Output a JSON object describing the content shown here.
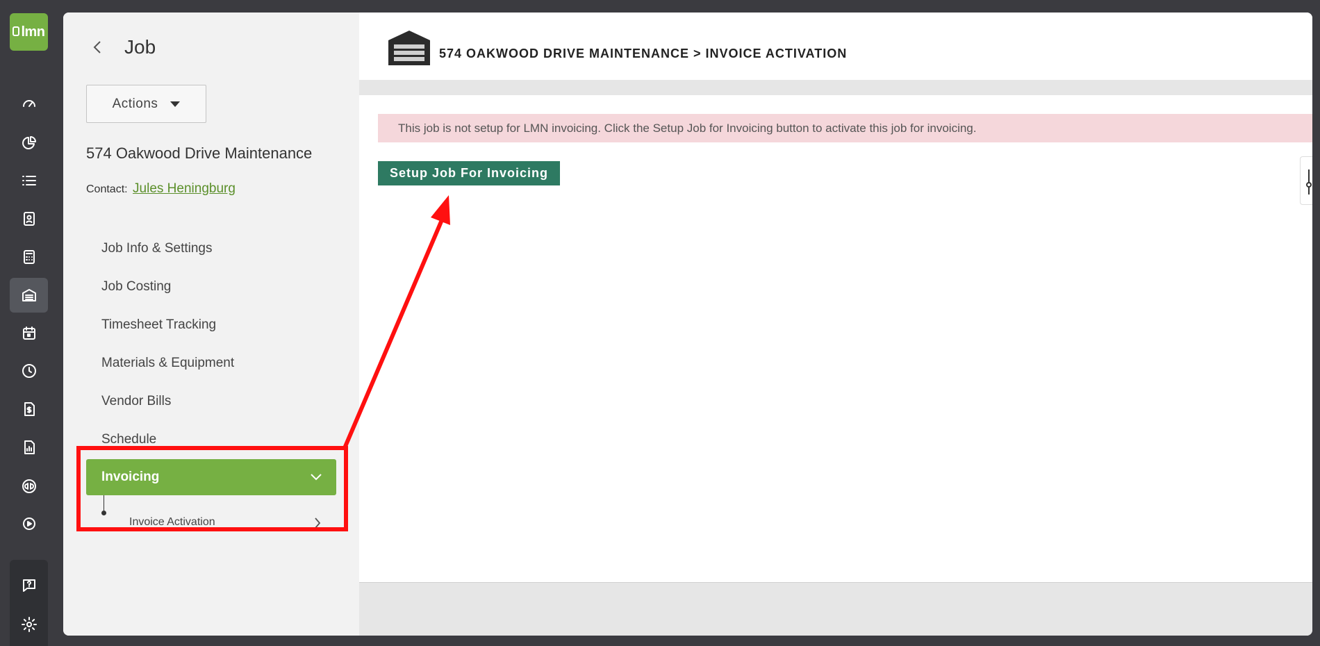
{
  "app": {
    "logo_text": "lmn",
    "brand_color": "#76b043",
    "accent_button_color": "#2e7a62",
    "alert_bg_color": "#f5d7db"
  },
  "rail": {
    "items": [
      {
        "name": "dashboard-icon"
      },
      {
        "name": "reports-pie-icon"
      },
      {
        "name": "list-icon"
      },
      {
        "name": "contact-card-icon"
      },
      {
        "name": "calculator-icon"
      },
      {
        "name": "jobs-garage-icon",
        "active": true
      },
      {
        "name": "calendar-icon"
      },
      {
        "name": "clock-icon"
      },
      {
        "name": "invoice-dollar-icon"
      },
      {
        "name": "report-chart-icon"
      },
      {
        "name": "quickbooks-icon"
      },
      {
        "name": "play-icon"
      },
      {
        "name": "help-icon"
      },
      {
        "name": "settings-gear-icon"
      }
    ]
  },
  "job_panel": {
    "title": "Job",
    "actions_label": "Actions",
    "job_name": "574 Oakwood Drive Maintenance",
    "contact_label": "Contact:",
    "contact_name": "Jules Heningburg",
    "nav": [
      {
        "label": "Job Info & Settings"
      },
      {
        "label": "Job Costing"
      },
      {
        "label": "Timesheet Tracking"
      },
      {
        "label": "Materials & Equipment"
      },
      {
        "label": "Vendor Bills"
      },
      {
        "label": "Schedule"
      },
      {
        "label": "Invoicing",
        "active": true
      }
    ],
    "sub_nav": [
      {
        "label": "Invoice Activation"
      }
    ]
  },
  "content": {
    "breadcrumb": "574 OAKWOOD DRIVE MAINTENANCE > INVOICE ACTIVATION",
    "alert_text": "This job is not setup for LMN invoicing. Click the Setup Job for Invoicing button to activate this job for invoicing.",
    "setup_button_label": "Setup Job For Invoicing"
  }
}
